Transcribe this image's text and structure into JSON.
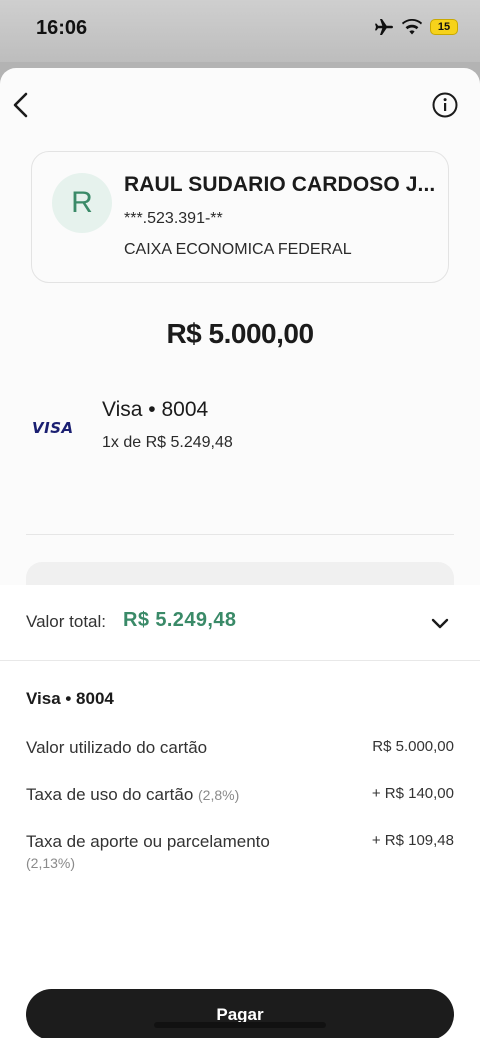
{
  "status_bar": {
    "time": "16:06",
    "battery": "15"
  },
  "recipient": {
    "initial": "R",
    "name": "RAUL SUDARIO CARDOSO J...",
    "document": "***.523.391-**",
    "bank": "CAIXA ECONOMICA FEDERAL"
  },
  "amount": "R$ 5.000,00",
  "card": {
    "brand_logo": "VISA",
    "title": "Visa • 8004",
    "installments": "1x de R$ 5.249,48"
  },
  "summary": {
    "total_label": "Valor total:",
    "total_value": "R$ 5.249,48",
    "card_title": "Visa • 8004",
    "lines": [
      {
        "label": "Valor utilizado do cartão",
        "pct": "",
        "value": "R$ 5.000,00"
      },
      {
        "label": "Taxa de uso do cartão",
        "pct": "(2,8%)",
        "value": "+ R$ 140,00"
      },
      {
        "label": "Taxa de aporte ou parcelamento",
        "pct": "(2,13%)",
        "value": "+ R$ 109,48"
      }
    ]
  },
  "actions": {
    "pay_label": "Pagar"
  },
  "colors": {
    "accent_green": "#3a8a68",
    "button_dark": "#1c1c1c",
    "visa_blue": "#1a1f71"
  }
}
